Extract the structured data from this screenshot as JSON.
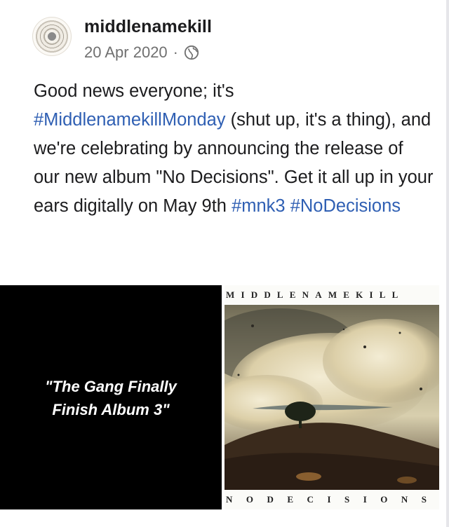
{
  "post": {
    "username": "middlenamekill",
    "date": "20 Apr 2020",
    "separator": "·",
    "privacy_icon": "globe-icon",
    "text": {
      "p1": "Good news everyone; it's",
      "hashtag1": "#MiddlenamekillMonday",
      "p2": " (shut up, it's a thing), and we're celebrating by announcing the release of our new album \"No Decisions\". Get it all up in your ears digitally on May 9th ",
      "hashtag2": "#mnk3",
      "hashtag3": "#NoDecisions"
    }
  },
  "media": {
    "left_caption_line1": "\"The Gang Finally",
    "left_caption_line2": "Finish Album 3\"",
    "album_band_top": "MIDDLENAMEKILL",
    "album_band_bottom": "NODECISIONS"
  },
  "colors": {
    "hashtag": "#2f5fb3",
    "text": "#1c1c1e",
    "meta": "#707070"
  }
}
